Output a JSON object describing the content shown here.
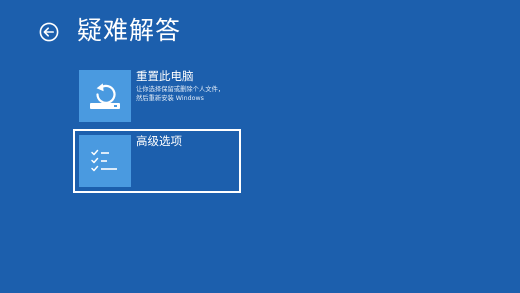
{
  "header": {
    "title": "疑难解答",
    "back_icon": "back-arrow-icon"
  },
  "options": [
    {
      "title": "重置此电脑",
      "desc_lines": [
        "让你选择保留或删除个人文件，",
        "然后重新安装 Windows"
      ],
      "icon": "reset-pc-icon"
    },
    {
      "title": "高级选项",
      "desc_lines": [],
      "icon": "checklist-icon",
      "selected": true
    }
  ],
  "colors": {
    "background": "#1c5fad",
    "tile": "#4a9ae0",
    "text": "#ffffff"
  }
}
